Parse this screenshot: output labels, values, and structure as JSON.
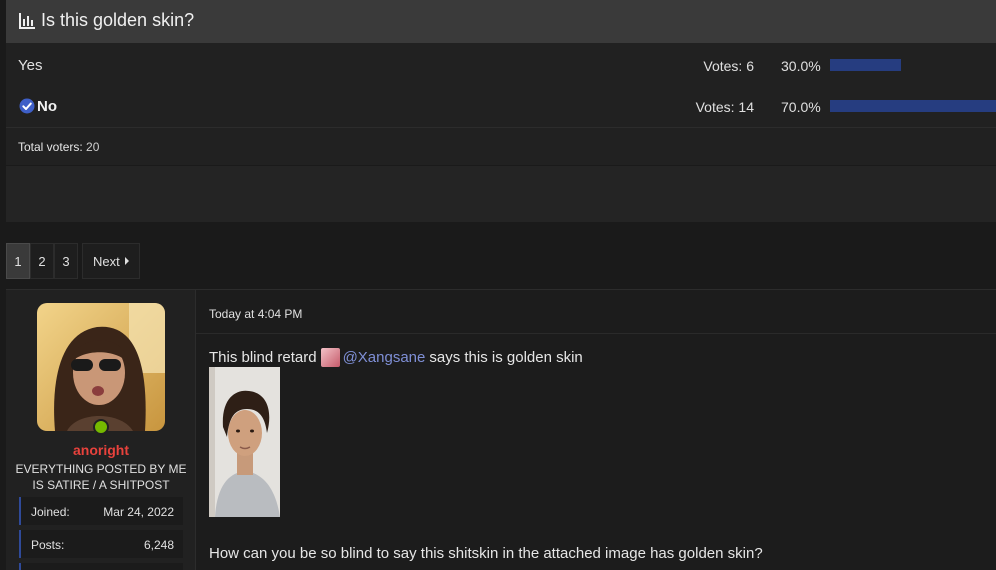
{
  "poll": {
    "title": "Is this golden skin?",
    "options": [
      {
        "label": "Yes",
        "votes_text": "Votes: 6",
        "percent_text": "30.0%",
        "share": 0.3
      },
      {
        "label": "No",
        "votes_text": "Votes: 14",
        "percent_text": "70.0%",
        "share": 0.7
      }
    ],
    "total_label": "Total voters:",
    "total_value": "20",
    "bar_color": "#263d80"
  },
  "pagination": {
    "pages": [
      "1",
      "2",
      "3"
    ],
    "current": "1",
    "next_label": "Next"
  },
  "post": {
    "username": "anoright",
    "username_color": "#e8423c",
    "user_title": "EVERYTHING POSTED BY ME IS SATIRE / A SHITPOST",
    "stats": [
      {
        "key": "Joined:",
        "value": "Mar 24, 2022"
      },
      {
        "key": "Posts:",
        "value": "6,248"
      }
    ],
    "date": "Today at 4:04 PM",
    "message_prefix": "This blind retard",
    "mention": "@Xangsane",
    "message_suffix": "says this is golden skin",
    "message_body": "How can you be so blind to say this shitskin in the attached image has golden skin?"
  }
}
